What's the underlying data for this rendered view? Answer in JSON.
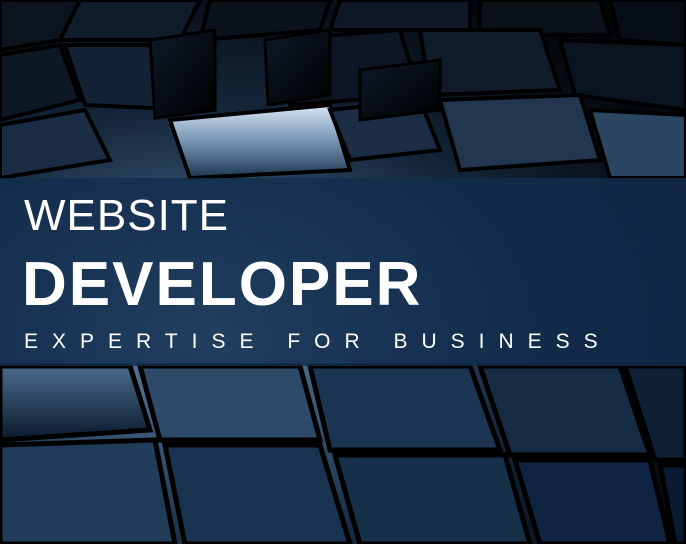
{
  "banner": {
    "title_light": "WEBSITE",
    "title_bold": "DEVELOPER",
    "tagline": "EXPERTISE FOR BUSINESS"
  },
  "colors": {
    "banner_overlay": "#122d4e",
    "text": "#ffffff",
    "cube_highlight": "#9fb9d2",
    "cube_shadow": "#03070c"
  }
}
